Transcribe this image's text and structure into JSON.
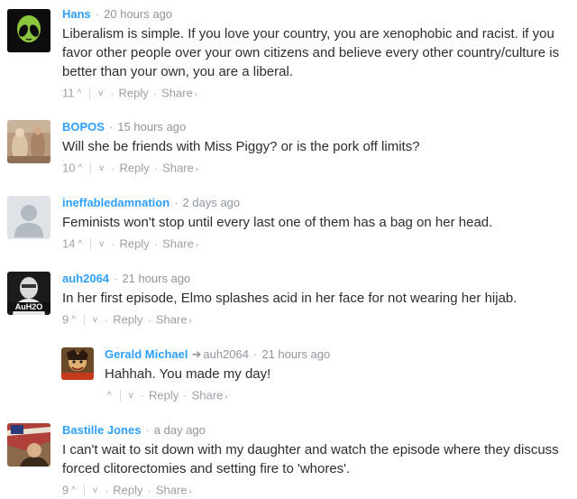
{
  "comments": [
    {
      "author": "Hans",
      "time": "20 hours ago",
      "text": "Liberalism is simple. If you love your country, you are xenophobic and racist. if you favor other people over your own citizens and believe every other country/culture is better than your own, you are a liberal.",
      "votes": "11",
      "avatar": "alien-avatar"
    },
    {
      "author": "BOPOS",
      "time": "15 hours ago",
      "text": "Will she be friends with Miss Piggy? or is the pork off limits?",
      "votes": "10",
      "avatar": "painting-avatar"
    },
    {
      "author": "ineffabledamnation",
      "time": "2 days ago",
      "text": "Feminists won't stop until every last one of them has a bag on her head.",
      "votes": "14",
      "avatar": "default-avatar"
    },
    {
      "author": "auh2064",
      "time": "21 hours ago",
      "text": "In her first episode, Elmo splashes acid in her face for not wearing her hijab.",
      "votes": "9",
      "avatar": "portrait-avatar",
      "avatar_caption": "AuH2O"
    },
    {
      "author": "Gerald Michael",
      "reply_to": "auh2064",
      "time": "21 hours ago",
      "text": "Hahhah. You made my day!",
      "votes": "",
      "avatar": "comic-avatar"
    },
    {
      "author": "Bastille Jones",
      "time": "a day ago",
      "text": "I can't wait to sit down with my daughter and watch the episode where they discuss forced clitorectomies and setting fire to 'whores'.",
      "votes": "9",
      "avatar": "flag-avatar"
    }
  ],
  "labels": {
    "reply": "Reply",
    "share": "Share",
    "dot": "·",
    "up": "^",
    "down": "v",
    "arrow": "›",
    "reply_arrow": "➜"
  },
  "colors": {
    "author": "#2e9fff",
    "text": "#2a2e2e",
    "muted": "#9aa0a6"
  }
}
